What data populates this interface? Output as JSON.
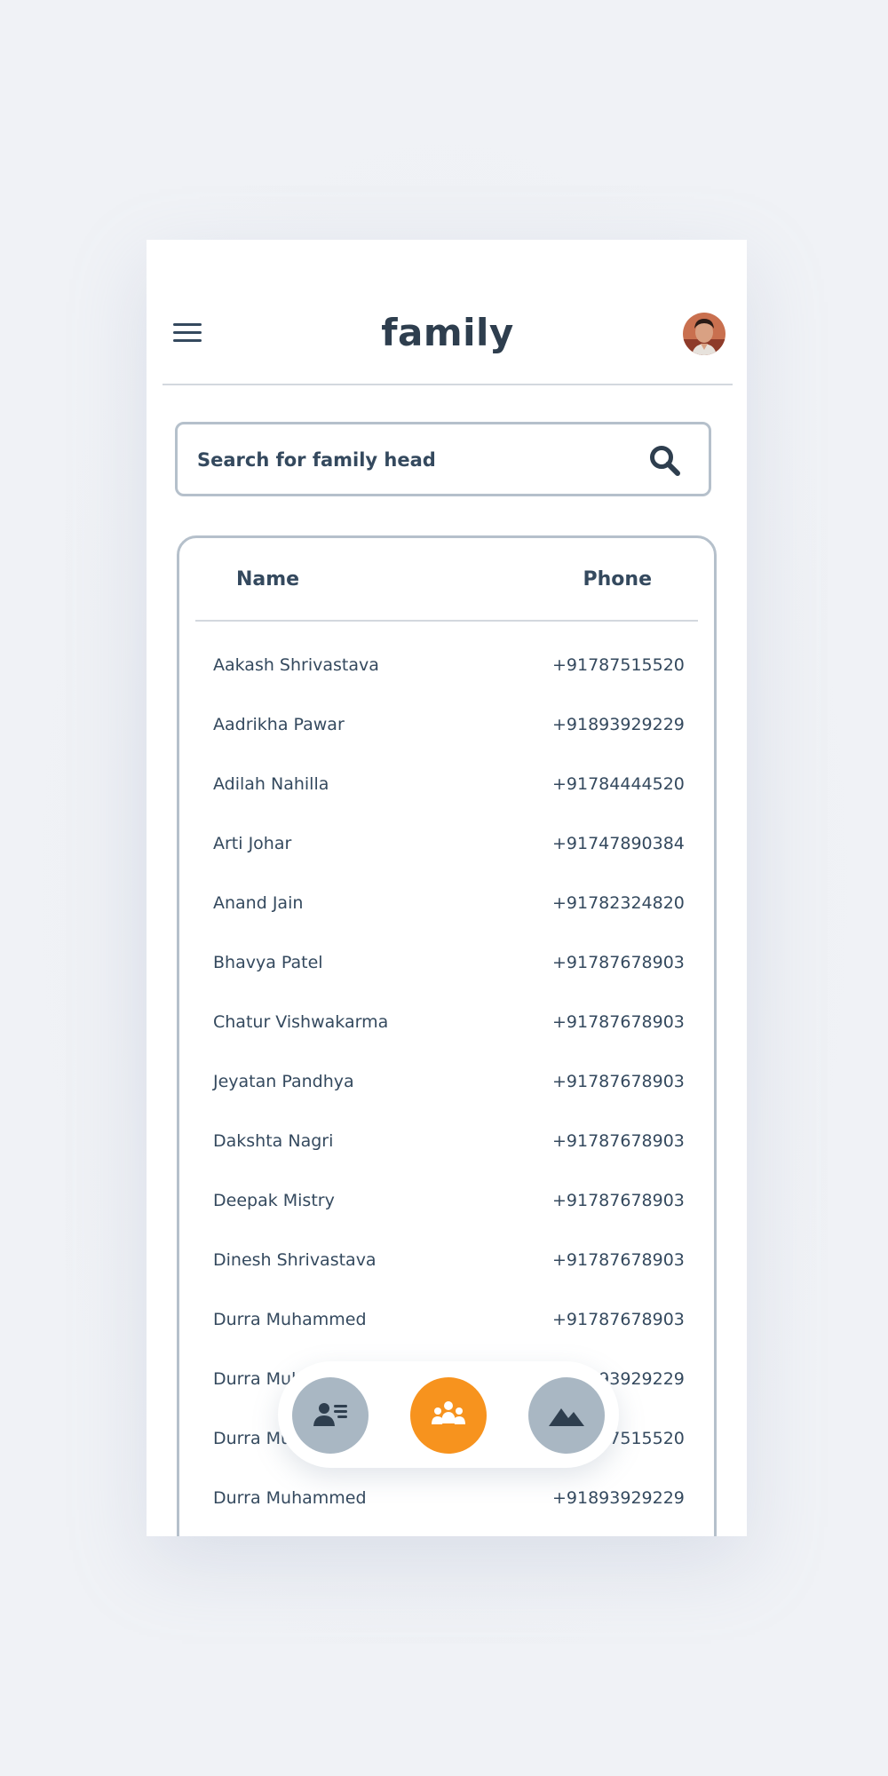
{
  "header": {
    "title": "family",
    "menu_icon": "hamburger-menu-icon",
    "avatar_icon": "user-avatar"
  },
  "search": {
    "placeholder": "Search for family head",
    "value": "",
    "icon": "search-icon"
  },
  "table": {
    "columns": [
      "Name",
      "Phone"
    ],
    "rows": [
      {
        "name": "Aakash Shrivastava",
        "phone": "+91787515520"
      },
      {
        "name": "Aadrikha Pawar",
        "phone": "+91893929229"
      },
      {
        "name": "Adilah Nahilla",
        "phone": "+91784444520"
      },
      {
        "name": "Arti Johar",
        "phone": "+91747890384"
      },
      {
        "name": "Anand Jain",
        "phone": "+91782324820"
      },
      {
        "name": "Bhavya Patel",
        "phone": "+91787678903"
      },
      {
        "name": "Chatur Vishwakarma",
        "phone": "+91787678903"
      },
      {
        "name": "Jeyatan Pandhya",
        "phone": "+91787678903"
      },
      {
        "name": "Dakshta Nagri",
        "phone": "+91787678903"
      },
      {
        "name": "Deepak Mistry",
        "phone": "+91787678903"
      },
      {
        "name": "Dinesh Shrivastava",
        "phone": "+91787678903"
      },
      {
        "name": "Durra Muhammed",
        "phone": "+91787678903"
      },
      {
        "name": "Durra Muhammed",
        "phone": "+91893929229"
      },
      {
        "name": "Durra Muhammed",
        "phone": "+91787515520"
      },
      {
        "name": "Durra Muhammed",
        "phone": "+91893929229"
      }
    ]
  },
  "bottom_nav": {
    "items": [
      {
        "icon": "contact-card-icon",
        "active": false
      },
      {
        "icon": "family-group-icon",
        "active": true
      },
      {
        "icon": "mountains-icon",
        "active": false
      }
    ]
  },
  "colors": {
    "accent": "#f7931e",
    "nav_inactive": "#a9b7c3",
    "text": "#34495e",
    "border": "#b5c0cb"
  }
}
